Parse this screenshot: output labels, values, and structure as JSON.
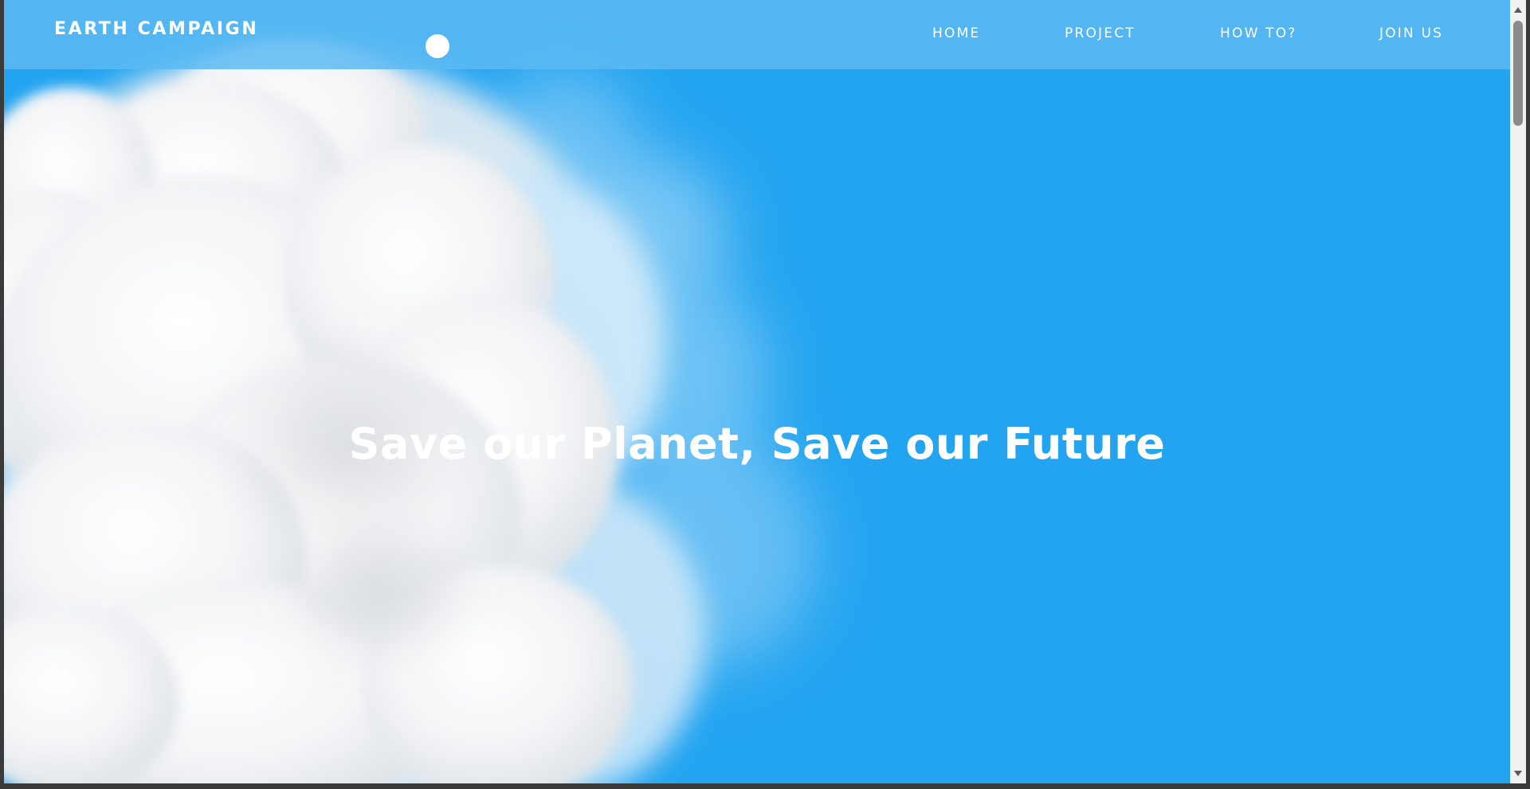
{
  "brand": "EARTH CAMPAIGN",
  "nav": {
    "items": [
      {
        "label": "HOME"
      },
      {
        "label": "PROJECT"
      },
      {
        "label": "HOW TO?"
      },
      {
        "label": "JOIN US"
      }
    ]
  },
  "hero": {
    "title": "Save our Planet, Save our Future"
  },
  "colors": {
    "sky": "#23a4f0",
    "navbar": "#5cbaf3",
    "text": "#ffffff"
  }
}
